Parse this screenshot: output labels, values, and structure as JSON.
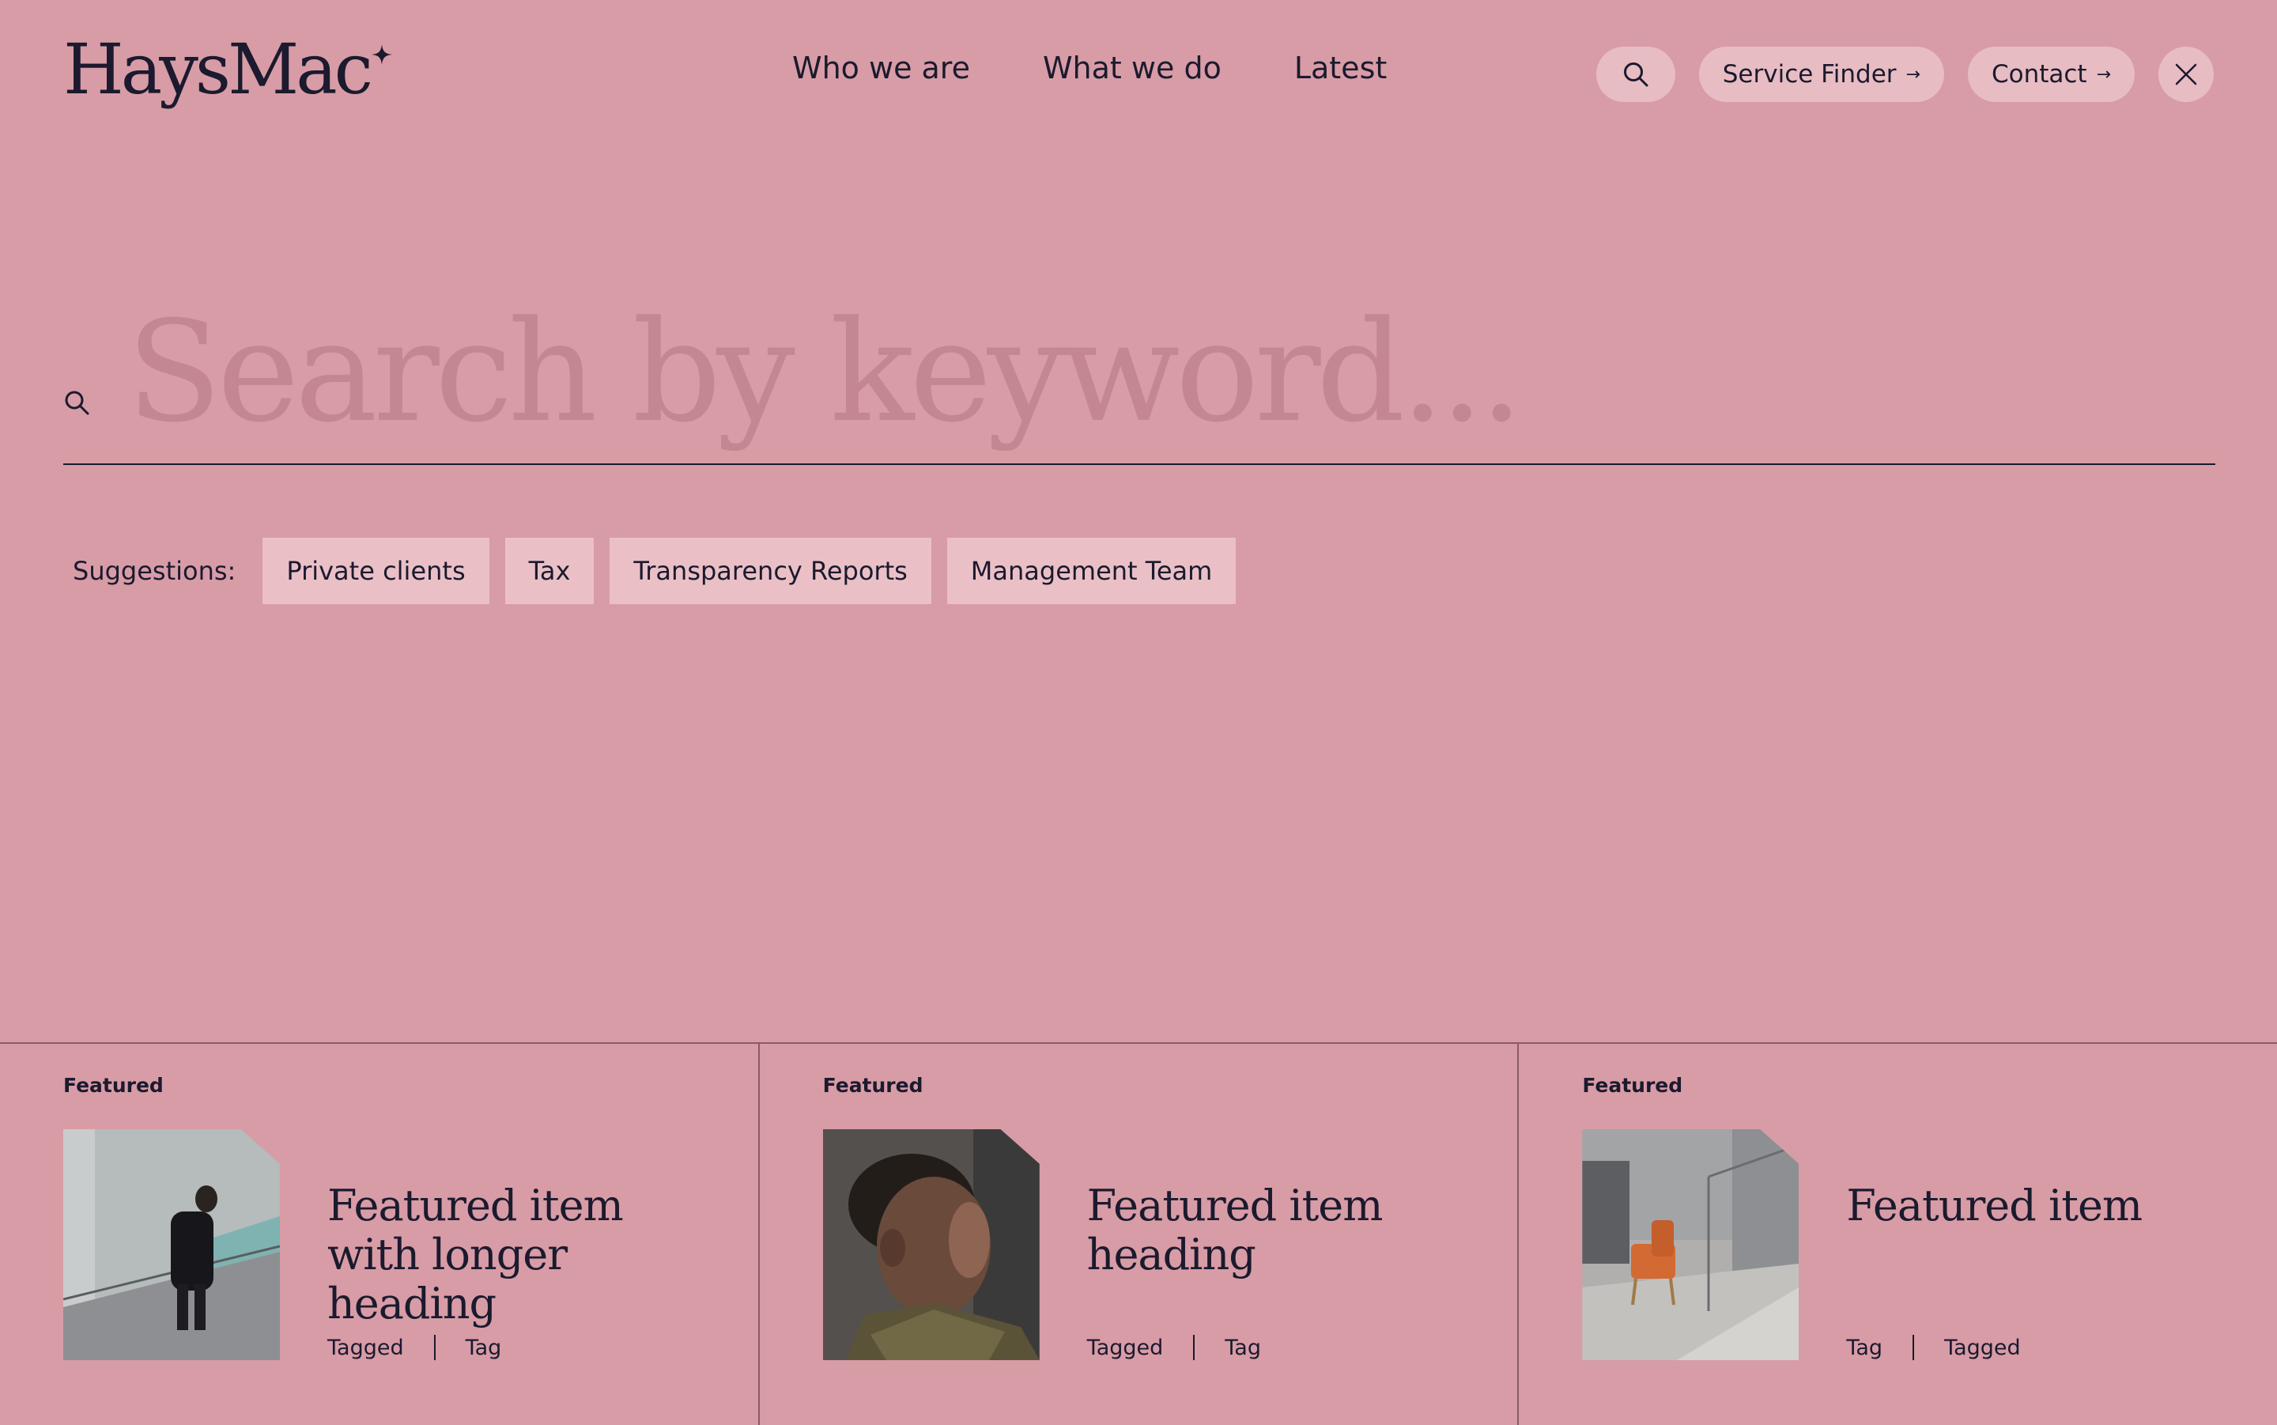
{
  "brand": {
    "logo_text": "HaysMac"
  },
  "nav": {
    "items": [
      {
        "label": "Who we are"
      },
      {
        "label": "What we do"
      },
      {
        "label": "Latest"
      }
    ]
  },
  "header_actions": {
    "service_finder_label": "Service Finder",
    "contact_label": "Contact",
    "arrow": "→"
  },
  "search": {
    "placeholder": "Search by keyword...",
    "value": ""
  },
  "suggestions": {
    "label": "Suggestions:",
    "chips": [
      "Private clients",
      "Tax",
      "Transparency Reports",
      "Management Team"
    ]
  },
  "featured": [
    {
      "label": "Featured",
      "heading": "Featured item with longer heading",
      "tags": [
        "Tagged",
        "Tag"
      ]
    },
    {
      "label": "Featured",
      "heading": "Featured item heading",
      "tags": [
        "Tagged",
        "Tag"
      ]
    },
    {
      "label": "Featured",
      "heading": "Featured item",
      "tags": [
        "Tag",
        "Tagged"
      ]
    }
  ],
  "colors": {
    "background": "#d89ca6",
    "text": "#1b1a2e",
    "pill": "#e8bcc3",
    "chip": "#eac0c6",
    "placeholder": "#c48792"
  }
}
